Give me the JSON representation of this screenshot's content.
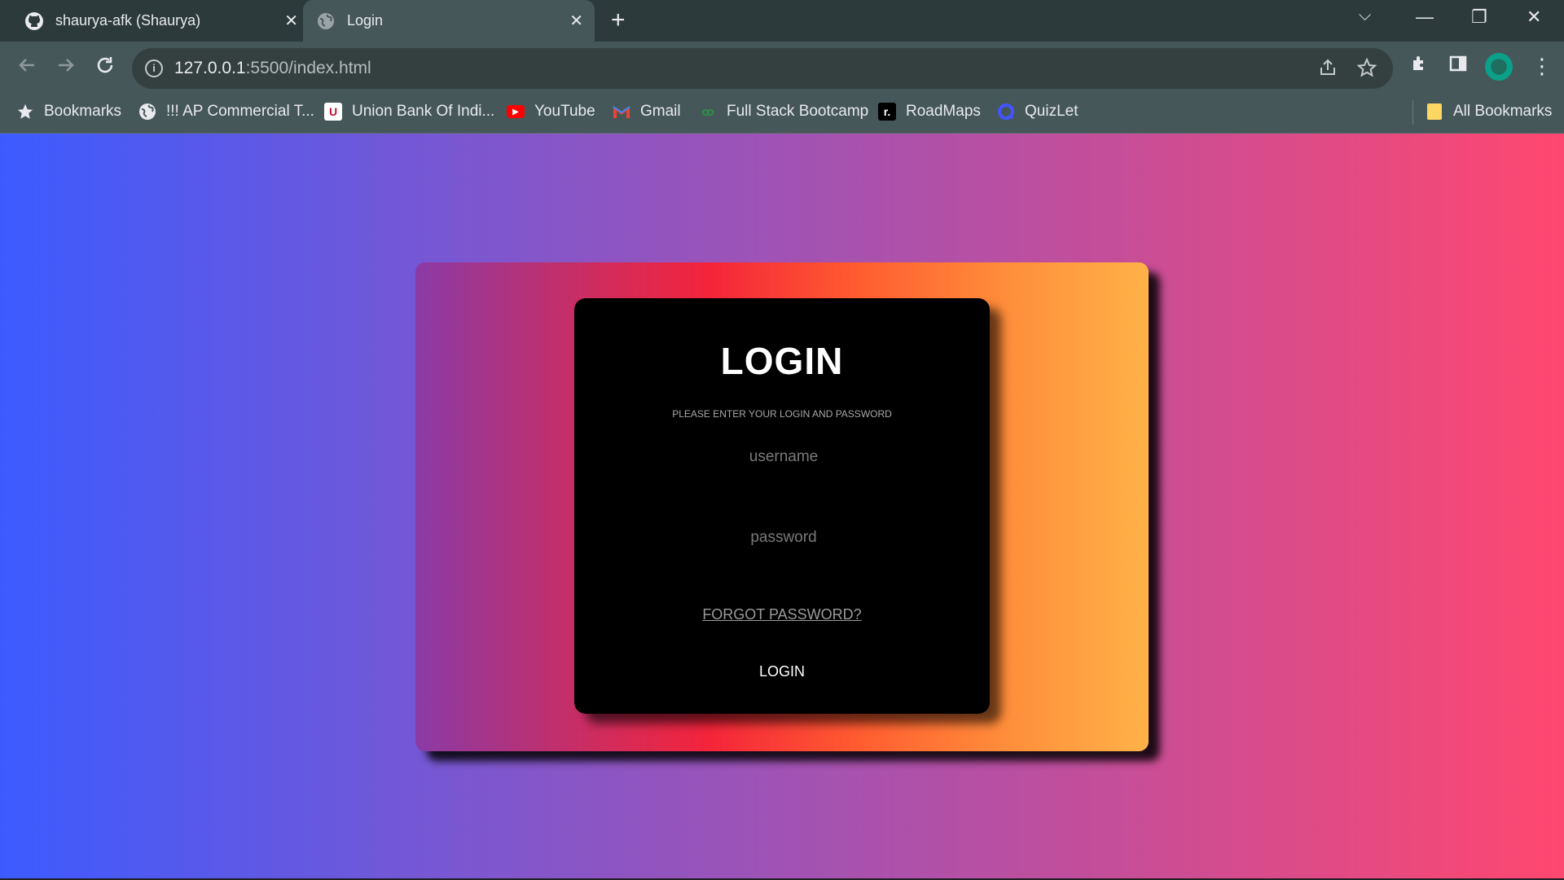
{
  "tabs": [
    {
      "title": "shaurya-afk (Shaurya)",
      "icon": "github-icon",
      "close": "✕"
    },
    {
      "title": "Login",
      "icon": "globe-icon",
      "close": "✕"
    }
  ],
  "new_tab": "+",
  "window_controls": {
    "dropdown": "⌵",
    "minimize": "—",
    "restore": "❐",
    "close": "✕"
  },
  "address_bar": {
    "host": "127.0.0.1",
    "rest": ":5500/index.html"
  },
  "bookmarks": [
    {
      "label": "Bookmarks",
      "icon": "star-icon"
    },
    {
      "label": "!!! AP Commercial T...",
      "icon": "globe-icon"
    },
    {
      "label": "Union Bank Of Indi...",
      "icon": "union-bank-icon"
    },
    {
      "label": "YouTube",
      "icon": "youtube-icon"
    },
    {
      "label": "Gmail",
      "icon": "gmail-icon"
    },
    {
      "label": "Full Stack Bootcamp",
      "icon": "bootcamp-icon"
    },
    {
      "label": "RoadMaps",
      "icon": "roadmaps-icon"
    },
    {
      "label": "QuizLet",
      "icon": "quizlet-icon"
    }
  ],
  "all_bookmarks": "All Bookmarks",
  "login": {
    "title": "LOGIN",
    "subtitle": "PLEASE ENTER YOUR LOGIN AND PASSWORD",
    "username_placeholder": "username",
    "password_placeholder": "password",
    "forgot": "FORGOT PASSWORD?",
    "button": "LOGIN"
  },
  "colors": {
    "page_gradient_start": "#3c5bff",
    "page_gradient_end": "#ff4770",
    "card_gradient_mid": "#f4243b",
    "card_gradient_end": "#ffb248",
    "login_box": "#000000"
  }
}
